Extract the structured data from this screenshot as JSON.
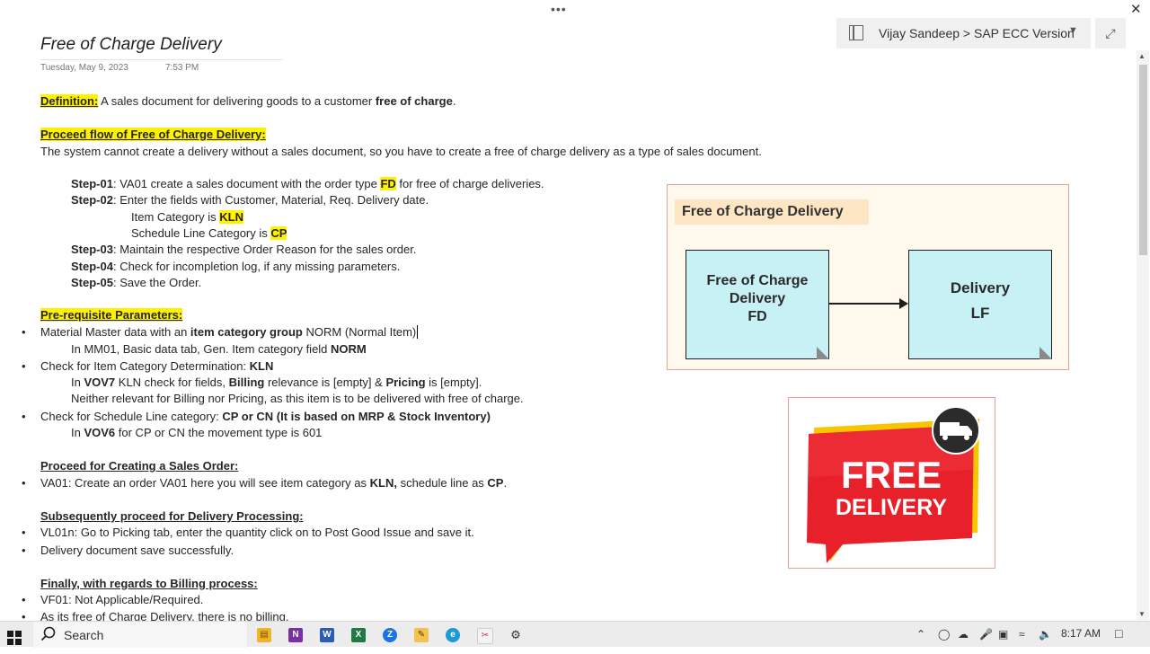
{
  "window": {
    "more_menu": "•••",
    "close": "✕"
  },
  "notebook": {
    "path": "Vijay Sandeep > SAP ECC Version",
    "expand": "⤢"
  },
  "page": {
    "title": "Free of Charge Delivery",
    "date": "Tuesday, May 9, 2023",
    "time": "7:53 PM"
  },
  "content": {
    "definition_label": "Definition:",
    "definition_text": " A sales document for delivering goods to a customer ",
    "definition_bold": "free of charge",
    "definition_end": ".",
    "proceed_heading": "Proceed flow of Free of Charge Delivery:",
    "proceed_text": "The system cannot create a delivery without a sales document, so you have to create a free of charge delivery as a type of sales document.",
    "step1_label": "Step-01",
    "step1_text": ": VA01 create a sales document with the order type ",
    "step1_code": "FD",
    "step1_end": " for free of charge deliveries.",
    "step2_label": "Step-02",
    "step2_text": ": Enter the fields with Customer, Material, Req. Delivery date.",
    "item_cat_text": "Item Category is ",
    "item_cat_code": "KLN",
    "sched_text": "Schedule Line Category is ",
    "sched_code": "CP",
    "step3_label": "Step-03",
    "step3_text": ": Maintain the respective Order Reason for the sales order.",
    "step4_label": "Step-04",
    "step4_text": ": Check for incompletion log, if any missing parameters.",
    "step5_label": "Step-05",
    "step5_text": ": Save the Order.",
    "prereq_heading": "Pre-requisite Parameters:",
    "pr1_a": "Material Master data with an ",
    "pr1_b": "item category group",
    "pr1_c": " NORM (Normal Item)",
    "pr1_sub_a": "In MM01, Basic data tab, Gen. Item category field ",
    "pr1_sub_b": "NORM",
    "pr2_a": "Check for Item Category Determination: ",
    "pr2_b": "KLN",
    "pr2_sub_a": "In ",
    "pr2_sub_b": "VOV7",
    "pr2_sub_c": " KLN check for fields, ",
    "pr2_sub_d": "Billing",
    "pr2_sub_e": " relevance is [empty] & ",
    "pr2_sub_f": "Pricing",
    "pr2_sub_g": " is [empty].",
    "pr2_sub2": "Neither relevant for Billing nor Pricing, as this item is to be delivered with free of charge.",
    "pr3_a": "Check for Schedule Line category: ",
    "pr3_b": "CP or CN (It is based on MRP & Stock Inventory)",
    "pr3_sub_a": "In ",
    "pr3_sub_b": "VOV6",
    "pr3_sub_c": " for CP or CN the movement type is 601",
    "so_heading": "Proceed for Creating a Sales Order:",
    "so_a": "VA01: Create an order VA01 here you will see item category as ",
    "so_b": "KLN,",
    "so_c": " schedule line as ",
    "so_d": "CP",
    "so_e": ".",
    "dp_heading": "Subsequently proceed for Delivery Processing:",
    "dp1": "VL01n: Go to Picking tab, enter the quantity click on to Post Good Issue and save it.",
    "dp2": "Delivery document save successfully.",
    "bp_heading": "Finally, with regards to Billing process:",
    "bp1": "VF01: Not Applicable/Required.",
    "bp2": "As its free of Charge Delivery, there is no billing."
  },
  "diagram": {
    "title": "Free of Charge Delivery",
    "box1_line1": "Free of Charge",
    "box1_line2": "Delivery",
    "box1_line3": "FD",
    "box2_line1": "Delivery",
    "box2_line2": "LF"
  },
  "badge": {
    "line1": "FREE",
    "line2": "DELIVERY"
  },
  "taskbar": {
    "search_label": "Search",
    "clock": "8:17 AM"
  },
  "colors": {
    "highlight": "#fff200",
    "diagram_box": "#c8f1f6",
    "badge_red": "#e8202a"
  }
}
